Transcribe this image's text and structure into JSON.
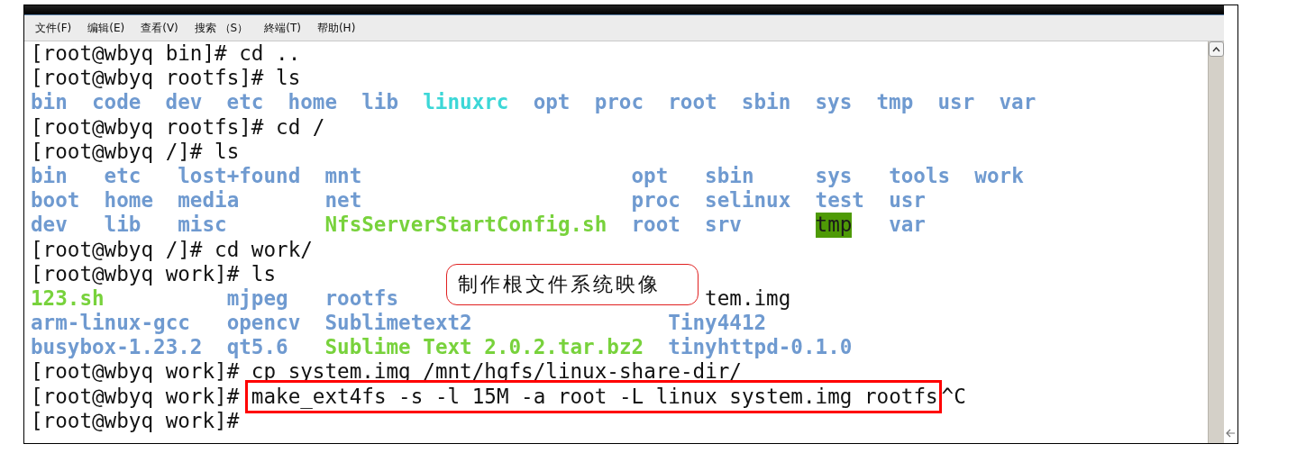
{
  "menu": [
    {
      "label": "文件(F)"
    },
    {
      "label": "编辑(E)"
    },
    {
      "label": "查看(V)"
    },
    {
      "label": "搜索 （S）"
    },
    {
      "label": "終端(T)"
    },
    {
      "label": "帮助(H)"
    }
  ],
  "terminal": {
    "lines": [
      {
        "kind": "command",
        "prompt": "[root@wbyq bin]#",
        "command": "cd .."
      },
      {
        "kind": "command",
        "prompt": "[root@wbyq rootfs]#",
        "command": "ls"
      },
      {
        "kind": "listing",
        "rows": [
          [
            {
              "name": "bin",
              "kind": "dir"
            },
            {
              "name": "code",
              "kind": "dir"
            },
            {
              "name": "dev",
              "kind": "dir"
            },
            {
              "name": "etc",
              "kind": "dir"
            },
            {
              "name": "home",
              "kind": "dir"
            },
            {
              "name": "lib",
              "kind": "dir"
            },
            {
              "name": "linuxrc",
              "kind": "link"
            },
            {
              "name": "opt",
              "kind": "dir"
            },
            {
              "name": "proc",
              "kind": "dir"
            },
            {
              "name": "root",
              "kind": "dir"
            },
            {
              "name": "sbin",
              "kind": "dir"
            },
            {
              "name": "sys",
              "kind": "dir"
            },
            {
              "name": "tmp",
              "kind": "dir"
            },
            {
              "name": "usr",
              "kind": "dir"
            },
            {
              "name": "var",
              "kind": "dir"
            }
          ]
        ]
      },
      {
        "kind": "command",
        "prompt": "[root@wbyq rootfs]#",
        "command": "cd /"
      },
      {
        "kind": "command",
        "prompt": "[root@wbyq /]#",
        "command": "ls"
      },
      {
        "kind": "listing",
        "rows": [
          [
            {
              "name": "bin",
              "kind": "dir"
            },
            {
              "name": "etc",
              "kind": "dir"
            },
            {
              "name": "lost+found",
              "kind": "dir"
            },
            {
              "name": "mnt",
              "kind": "dir"
            },
            {
              "name": "opt",
              "kind": "dir"
            },
            {
              "name": "sbin",
              "kind": "dir"
            },
            {
              "name": "sys",
              "kind": "dir"
            },
            {
              "name": "tools",
              "kind": "dir"
            },
            {
              "name": "work",
              "kind": "dir"
            }
          ],
          [
            {
              "name": "boot",
              "kind": "dir"
            },
            {
              "name": "home",
              "kind": "dir"
            },
            {
              "name": "media",
              "kind": "dir"
            },
            {
              "name": "net",
              "kind": "dir"
            },
            {
              "name": "proc",
              "kind": "dir"
            },
            {
              "name": "selinux",
              "kind": "dir"
            },
            {
              "name": "test",
              "kind": "dir"
            },
            {
              "name": "usr",
              "kind": "dir"
            }
          ],
          [
            {
              "name": "dev",
              "kind": "dir"
            },
            {
              "name": "lib",
              "kind": "dir"
            },
            {
              "name": "misc",
              "kind": "dir"
            },
            {
              "name": "NfsServerStartConfig.sh",
              "kind": "exec"
            },
            {
              "name": "root",
              "kind": "dir"
            },
            {
              "name": "srv",
              "kind": "dir"
            },
            {
              "name": "tmp",
              "kind": "sticky"
            },
            {
              "name": "var",
              "kind": "dir"
            }
          ]
        ]
      },
      {
        "kind": "command",
        "prompt": "[root@wbyq /]#",
        "command": "cd work/"
      },
      {
        "kind": "command",
        "prompt": "[root@wbyq work]#",
        "command": "ls"
      },
      {
        "kind": "listing",
        "rows": [
          [
            {
              "name": "123.sh",
              "kind": "exec"
            },
            {
              "name": "mjpeg",
              "kind": "dir"
            },
            {
              "name": "rootfs",
              "kind": "dir"
            },
            {
              "name": "tem.img",
              "kind": "file",
              "partly_covered": true
            }
          ],
          [
            {
              "name": "arm-linux-gcc",
              "kind": "dir"
            },
            {
              "name": "opencv",
              "kind": "dir"
            },
            {
              "name": "Sublimetext2",
              "kind": "dir"
            },
            {
              "name": "Tiny4412",
              "kind": "dir"
            }
          ],
          [
            {
              "name": "busybox-1.23.2",
              "kind": "dir"
            },
            {
              "name": "qt5.6",
              "kind": "dir"
            },
            {
              "name": "Sublime Text 2.0.2.tar.bz2",
              "kind": "exec"
            },
            {
              "name": "tinyhttpd-0.1.0",
              "kind": "dir"
            }
          ]
        ]
      },
      {
        "kind": "command",
        "prompt": "[root@wbyq work]#",
        "command": "cp system.img /mnt/hgfs/linux-share-dir/"
      },
      {
        "kind": "command",
        "prompt": "[root@wbyq work]#",
        "command": "make_ext4fs -s -l 15M -a root -L linux system.img rootfs",
        "boxed": true,
        "suffix": "^C"
      },
      {
        "kind": "command",
        "prompt": "[root@wbyq work]#"
      }
    ]
  },
  "callout": {
    "text": "制作根文件系统映像"
  }
}
